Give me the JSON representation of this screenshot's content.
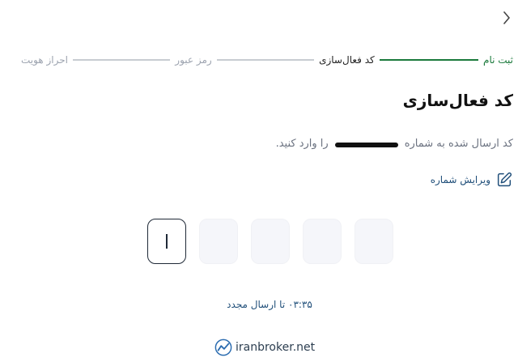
{
  "header": {
    "back_icon": "chevron-right-icon"
  },
  "steps": [
    {
      "label": "ثبت نام",
      "state": "done"
    },
    {
      "label": "کد فعال‌سازی",
      "state": "active"
    },
    {
      "label": "رمز عبور",
      "state": "upcoming"
    },
    {
      "label": "احراز هویت",
      "state": "upcoming"
    }
  ],
  "main": {
    "title": "کد فعال‌سازی",
    "description_before": "کد ارسال شده به شماره",
    "description_after": "را وارد کنید.",
    "edit_label": "ویرایش شماره",
    "edit_icon": "edit-icon"
  },
  "code": {
    "length": 5,
    "values": [
      "",
      "",
      "",
      "",
      ""
    ],
    "focused_index": 0
  },
  "resend": {
    "timer": "۰۳:۳۵",
    "text": "تا ارسال مجدد"
  },
  "brand": {
    "name": "iranbroker.net",
    "logo_icon": "chart-logo-icon"
  },
  "colors": {
    "accent": "#1b7a3c",
    "link": "#1f4e79",
    "muted": "#9ca3af",
    "text": "#111111"
  }
}
